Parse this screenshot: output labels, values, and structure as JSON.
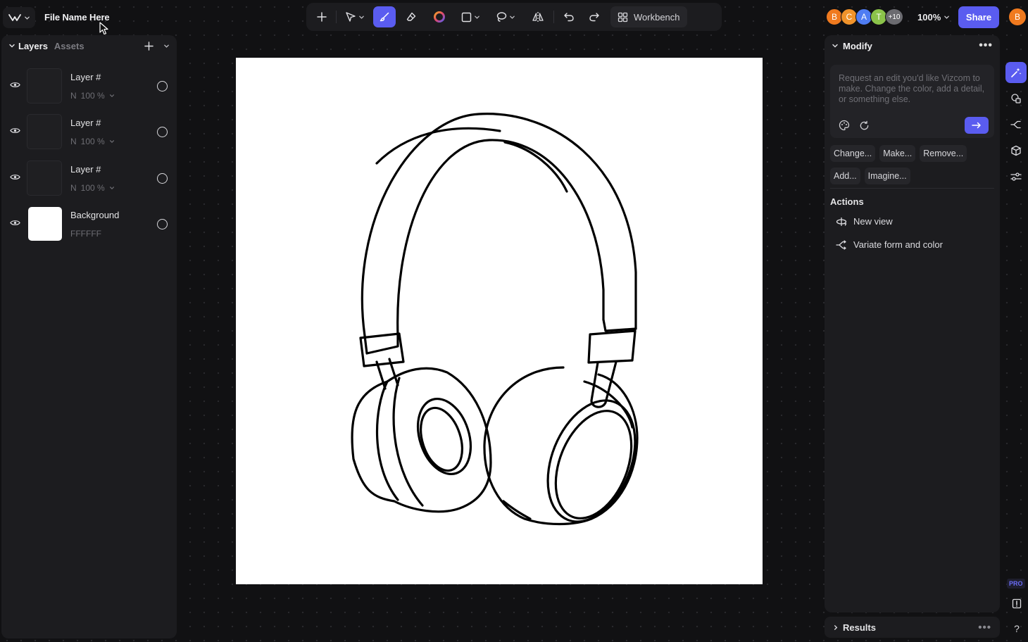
{
  "header": {
    "file_name": "File Name Here",
    "zoom": "100%",
    "share_label": "Share",
    "current_user_initial": "B"
  },
  "collaborators": [
    {
      "initial": "B",
      "color": "#f07a1f"
    },
    {
      "initial": "C",
      "color": "#f0932b"
    },
    {
      "initial": "A",
      "color": "#4f7df3"
    },
    {
      "initial": "T",
      "color": "#8bc34a"
    }
  ],
  "collaborators_more": "+10",
  "toolbar": {
    "workbench_label": "Workbench",
    "active_tool": "brush"
  },
  "left_panel": {
    "tab_layers": "Layers",
    "tab_assets": "Assets",
    "layers": [
      {
        "name": "Layer #",
        "blend": "N",
        "opacity": "100 %"
      },
      {
        "name": "Layer #",
        "blend": "N",
        "opacity": "100 %"
      },
      {
        "name": "Layer #",
        "blend": "N",
        "opacity": "100 %"
      }
    ],
    "background": {
      "name": "Background",
      "color": "FFFFFF"
    }
  },
  "right_panel": {
    "title": "Modify",
    "prompt_placeholder": "Request an edit you'd like Vizcom to make. Change the color, add a detail, or something else.",
    "chips": [
      "Change...",
      "Make...",
      "Remove...",
      "Add...",
      "Imagine..."
    ],
    "actions_title": "Actions",
    "actions": [
      "New view",
      "Variate form and color"
    ],
    "results_title": "Results"
  },
  "rail": {
    "pro_label": "PRO",
    "help_label": "?"
  },
  "colors": {
    "accent": "#5a5cf0",
    "panel": "#1c1c1f",
    "canvas_bg": "#111113"
  }
}
